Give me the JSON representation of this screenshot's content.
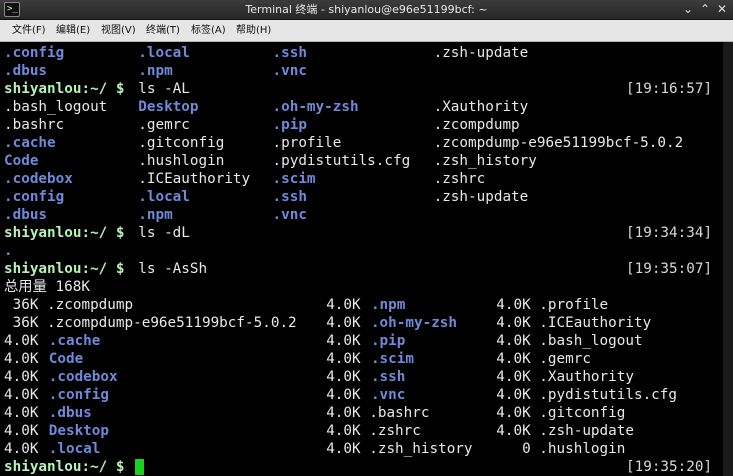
{
  "window": {
    "title": "Terminal 终端 - shiyanlou@e96e51199bcf: ~",
    "icon_text": ">_",
    "controls": {
      "minimize": "⌄",
      "maximize": "⌃",
      "close": "✕"
    }
  },
  "menu": {
    "items": [
      "文件(F)",
      "编辑(E)",
      "视图(V)",
      "终端(T)",
      "标签(A)",
      "帮助(H)"
    ]
  },
  "terminal": {
    "lines": [
      {
        "cells": [
          {
            "text": ".config",
            "col": 0,
            "dir": true
          },
          {
            "text": ".local",
            "col": 15,
            "dir": true
          },
          {
            "text": ".ssh",
            "col": 30,
            "dir": true
          },
          {
            "text": ".zsh-update",
            "col": 48
          }
        ]
      },
      {
        "cells": [
          {
            "text": ".dbus",
            "col": 0,
            "dir": true
          },
          {
            "text": ".npm",
            "col": 15,
            "dir": true
          },
          {
            "text": ".vnc",
            "col": 30,
            "dir": true
          }
        ]
      },
      {
        "prompt": "shiyanlou:~/ $",
        "cmd": "ls -AL",
        "time": "[19:16:57]"
      },
      {
        "cells": [
          {
            "text": ".bash_logout",
            "col": 0
          },
          {
            "text": "Desktop",
            "col": 15,
            "dir": true
          },
          {
            "text": ".oh-my-zsh",
            "col": 30,
            "dir": true
          },
          {
            "text": ".Xauthority",
            "col": 48
          }
        ]
      },
      {
        "cells": [
          {
            "text": ".bashrc",
            "col": 0
          },
          {
            "text": ".gemrc",
            "col": 15
          },
          {
            "text": ".pip",
            "col": 30,
            "dir": true
          },
          {
            "text": ".zcompdump",
            "col": 48
          }
        ]
      },
      {
        "cells": [
          {
            "text": ".cache",
            "col": 0,
            "dir": true
          },
          {
            "text": ".gitconfig",
            "col": 15
          },
          {
            "text": ".profile",
            "col": 30
          },
          {
            "text": ".zcompdump-e96e51199bcf-5.0.2",
            "col": 48
          }
        ]
      },
      {
        "cells": [
          {
            "text": "Code",
            "col": 0,
            "dir": true
          },
          {
            "text": ".hushlogin",
            "col": 15
          },
          {
            "text": ".pydistutils.cfg",
            "col": 30
          },
          {
            "text": ".zsh_history",
            "col": 48
          }
        ]
      },
      {
        "cells": [
          {
            "text": ".codebox",
            "col": 0,
            "dir": true
          },
          {
            "text": ".ICEauthority",
            "col": 15
          },
          {
            "text": ".scim",
            "col": 30,
            "dir": true
          },
          {
            "text": ".zshrc",
            "col": 48
          }
        ]
      },
      {
        "cells": [
          {
            "text": ".config",
            "col": 0,
            "dir": true
          },
          {
            "text": ".local",
            "col": 15,
            "dir": true
          },
          {
            "text": ".ssh",
            "col": 30,
            "dir": true
          },
          {
            "text": ".zsh-update",
            "col": 48
          }
        ]
      },
      {
        "cells": [
          {
            "text": ".dbus",
            "col": 0,
            "dir": true
          },
          {
            "text": ".npm",
            "col": 15,
            "dir": true
          },
          {
            "text": ".vnc",
            "col": 30,
            "dir": true
          }
        ]
      },
      {
        "prompt": "shiyanlou:~/ $",
        "cmd": "ls -dL",
        "time": "[19:34:34]"
      },
      {
        "cells": [
          {
            "text": ".",
            "col": 0,
            "dir": true
          }
        ]
      },
      {
        "prompt": "shiyanlou:~/ $",
        "cmd": "ls -AsSh",
        "time": "[19:35:07]"
      },
      {
        "cells": [
          {
            "text": "总用量 168K",
            "col": 0
          }
        ]
      },
      {
        "cells": [
          {
            "text": " 36K .zcompdump",
            "col": 0
          },
          {
            "text": "4.0K",
            "col": 36
          },
          {
            "text": ".npm",
            "col": 41,
            "dir": true
          },
          {
            "text": "4.0K .profile",
            "col": 55
          }
        ]
      },
      {
        "cells": [
          {
            "text": " 36K .zcompdump-e96e51199bcf-5.0.2",
            "col": 0
          },
          {
            "text": "4.0K",
            "col": 36
          },
          {
            "text": ".oh-my-zsh",
            "col": 41,
            "dir": true
          },
          {
            "text": "4.0K .ICEauthority",
            "col": 55
          }
        ]
      },
      {
        "cells": [
          {
            "text": "4.0K",
            "col": 0
          },
          {
            "text": ".cache",
            "col": 5,
            "dir": true
          },
          {
            "text": "4.0K",
            "col": 36
          },
          {
            "text": ".pip",
            "col": 41,
            "dir": true
          },
          {
            "text": "4.0K .bash_logout",
            "col": 55
          }
        ]
      },
      {
        "cells": [
          {
            "text": "4.0K",
            "col": 0
          },
          {
            "text": "Code",
            "col": 5,
            "dir": true
          },
          {
            "text": "4.0K",
            "col": 36
          },
          {
            "text": ".scim",
            "col": 41,
            "dir": true
          },
          {
            "text": "4.0K .gemrc",
            "col": 55
          }
        ]
      },
      {
        "cells": [
          {
            "text": "4.0K",
            "col": 0
          },
          {
            "text": ".codebox",
            "col": 5,
            "dir": true
          },
          {
            "text": "4.0K",
            "col": 36
          },
          {
            "text": ".ssh",
            "col": 41,
            "dir": true
          },
          {
            "text": "4.0K .Xauthority",
            "col": 55
          }
        ]
      },
      {
        "cells": [
          {
            "text": "4.0K",
            "col": 0
          },
          {
            "text": ".config",
            "col": 5,
            "dir": true
          },
          {
            "text": "4.0K",
            "col": 36
          },
          {
            "text": ".vnc",
            "col": 41,
            "dir": true
          },
          {
            "text": "4.0K .pydistutils.cfg",
            "col": 55
          }
        ]
      },
      {
        "cells": [
          {
            "text": "4.0K",
            "col": 0
          },
          {
            "text": ".dbus",
            "col": 5,
            "dir": true
          },
          {
            "text": "4.0K .bashrc",
            "col": 36
          },
          {
            "text": "4.0K .gitconfig",
            "col": 55
          }
        ]
      },
      {
        "cells": [
          {
            "text": "4.0K",
            "col": 0
          },
          {
            "text": "Desktop",
            "col": 5,
            "dir": true
          },
          {
            "text": "4.0K .zshrc",
            "col": 36
          },
          {
            "text": "4.0K .zsh-update",
            "col": 55
          }
        ]
      },
      {
        "cells": [
          {
            "text": "4.0K",
            "col": 0
          },
          {
            "text": ".local",
            "col": 5,
            "dir": true
          },
          {
            "text": "4.0K .zsh_history",
            "col": 36
          },
          {
            "text": "   0 .hushlogin",
            "col": 55
          }
        ]
      },
      {
        "prompt": "shiyanlou:~/ $",
        "cmd": "",
        "time": "[19:35:20]",
        "cursor": true
      }
    ]
  }
}
